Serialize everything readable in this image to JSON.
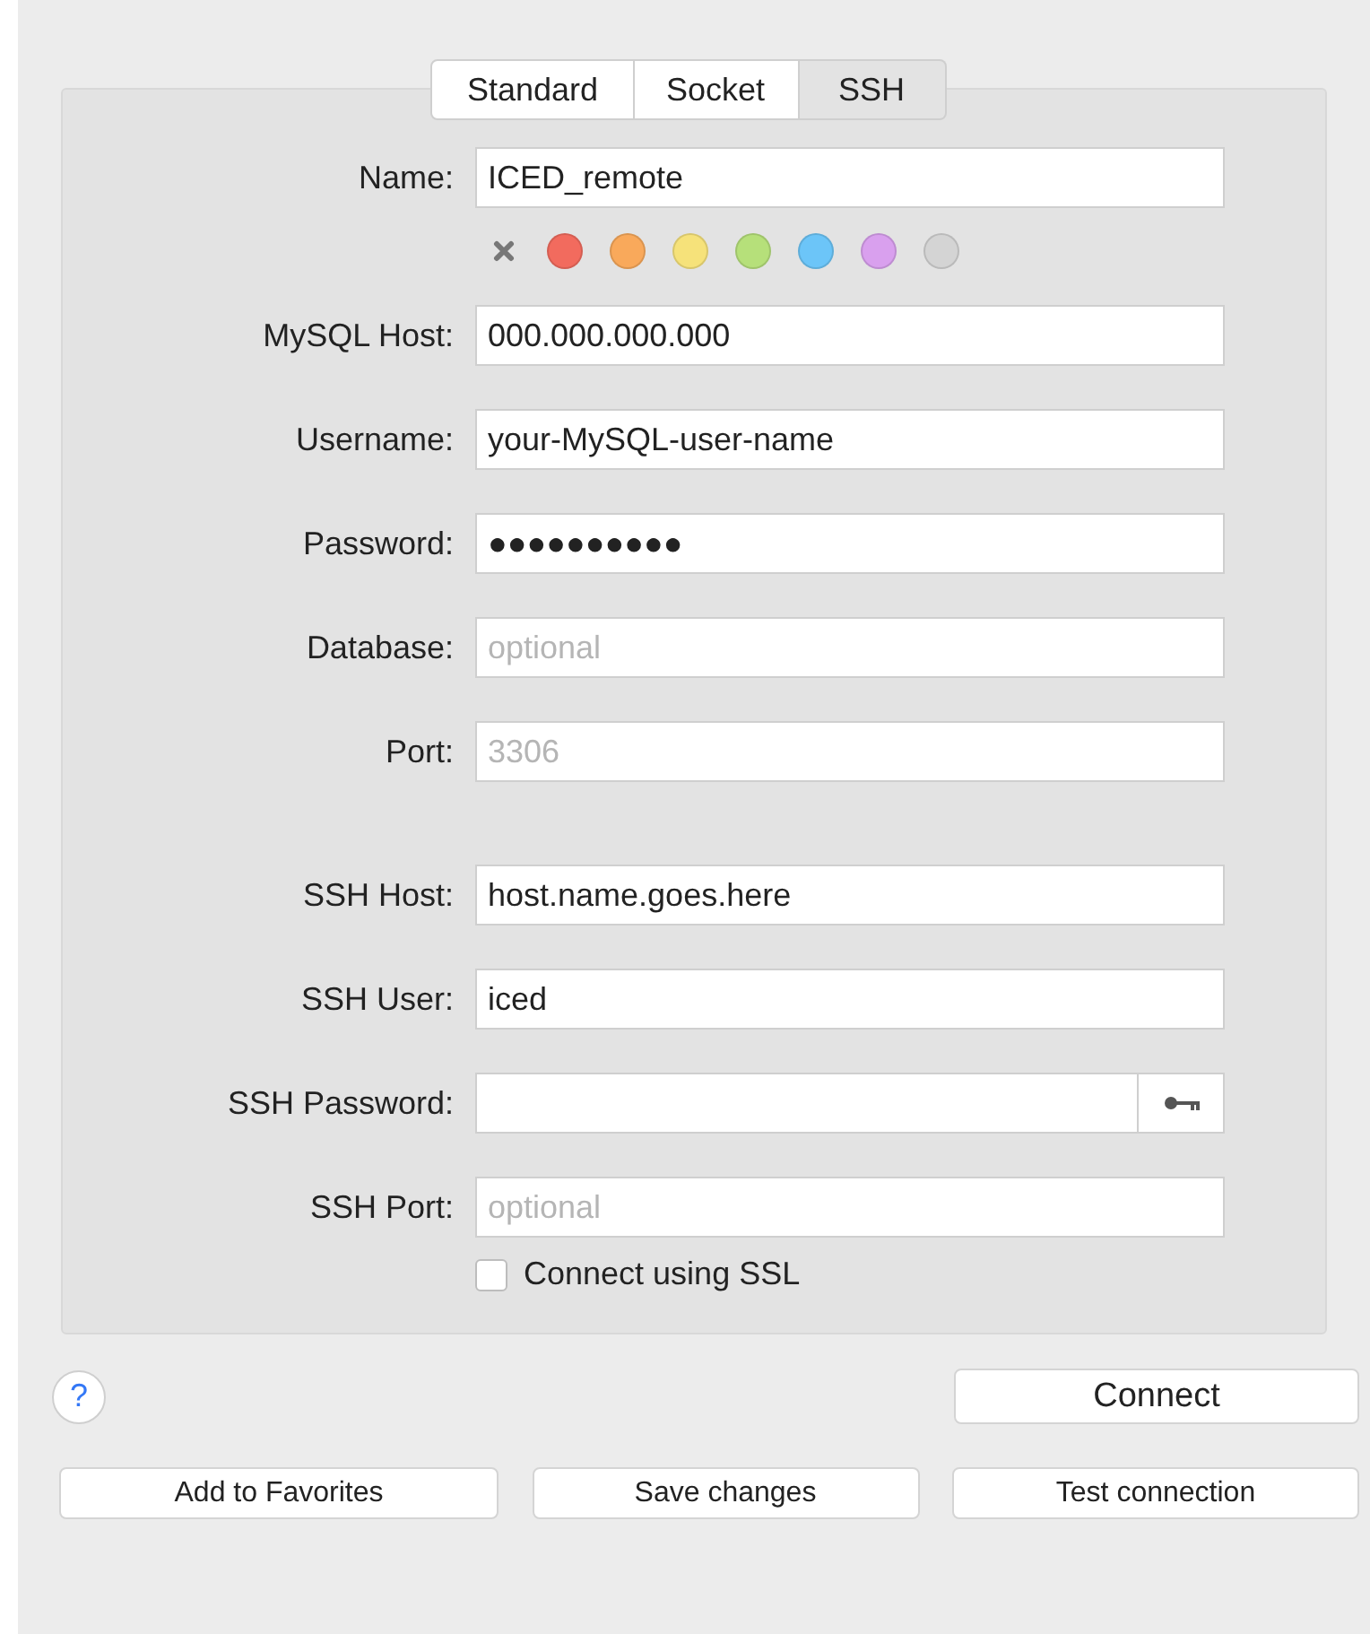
{
  "tabs": [
    {
      "label": "Standard",
      "selected": false
    },
    {
      "label": "Socket",
      "selected": false
    },
    {
      "label": "SSH",
      "selected": true
    }
  ],
  "name_field": {
    "label": "Name:",
    "value": "ICED_remote"
  },
  "colors": [
    {
      "color": "#f26b5e"
    },
    {
      "color": "#f9a95b"
    },
    {
      "color": "#f6e27a"
    },
    {
      "color": "#b6e07a"
    },
    {
      "color": "#6cc5f8"
    },
    {
      "color": "#d9a0ee"
    },
    {
      "color": "#d4d4d4"
    }
  ],
  "fields": [
    {
      "kind": "text",
      "label": "MySQL Host:",
      "value": "000.000.000.000"
    },
    {
      "kind": "text",
      "label": "Username:",
      "value": "your-MySQL-user-name"
    },
    {
      "kind": "text",
      "label": "Password:",
      "value": "●●●●●●●●●●"
    },
    {
      "kind": "text",
      "label": "Database:",
      "placeholder": "optional"
    },
    {
      "kind": "text",
      "label": "Port:",
      "placeholder": "3306"
    }
  ],
  "ssh_fields": [
    {
      "kind": "text",
      "label": "SSH Host:",
      "value": "host.name.goes.here"
    },
    {
      "kind": "text",
      "label": "SSH User:",
      "value": "iced"
    },
    {
      "kind": "keychain",
      "label": "SSH Password:"
    },
    {
      "kind": "text",
      "label": "SSH Port:",
      "placeholder": "optional"
    }
  ],
  "ssl_checkbox": {
    "label": "Connect using SSL",
    "checked": false
  },
  "help_button": {
    "label": "?"
  },
  "connect_button": {
    "label": "Connect"
  },
  "buttons": [
    {
      "label": "Add to Favorites"
    },
    {
      "label": "Save changes"
    },
    {
      "label": "Test connection"
    }
  ]
}
